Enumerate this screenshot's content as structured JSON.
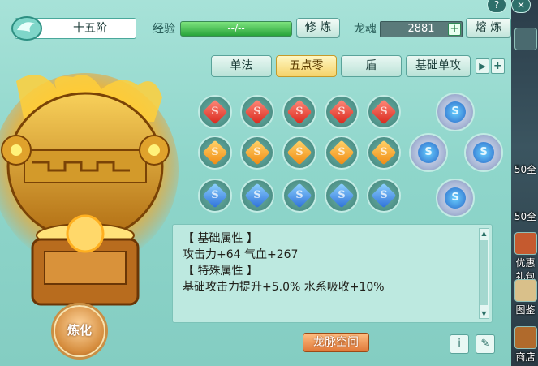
{
  "header": {
    "tier": "十五阶",
    "exp_label": "经验",
    "exp_value": "--/--",
    "refine_button": "修 炼",
    "soul_label": "龙魂",
    "soul_value": "2881",
    "smelt_button": "熔 炼",
    "help_icon": "?",
    "close_icon": "×"
  },
  "tabs": [
    {
      "label": "单法",
      "active": false
    },
    {
      "label": "五点零",
      "active": true
    },
    {
      "label": "盾",
      "active": false
    },
    {
      "label": "基础单攻",
      "active": false
    }
  ],
  "gems": {
    "rows": [
      {
        "color": "red",
        "count": 5
      },
      {
        "color": "orange",
        "count": 5
      },
      {
        "color": "blue",
        "count": 5
      }
    ],
    "star_slots": 4
  },
  "info": {
    "basic_header": "【 基础属性 】",
    "basic_line": "攻击力+64  气血+267",
    "special_header": "【 特殊属性 】",
    "special_line": "基础攻击力提升+5.0% 水系吸收+10%"
  },
  "buttons": {
    "refine_round": "炼化",
    "dragon_space": "龙脉空间",
    "info_icon": "i",
    "edit_icon": "✎"
  },
  "side": {
    "gift_label": "优惠礼包",
    "codex_label": "图鉴",
    "shop_label": "商店",
    "right_text_1": "50全",
    "right_text_2": "50全"
  }
}
